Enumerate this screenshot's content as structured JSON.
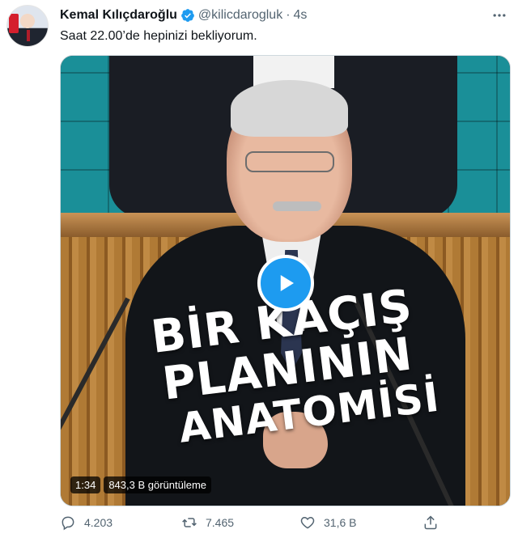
{
  "tweet": {
    "author_name": "Kemal Kılıçdaroğlu",
    "handle": "@kilicdarogluk",
    "separator": "·",
    "time": "4s",
    "text": "Saat 22.00’de hepinizi bekliyorum."
  },
  "video": {
    "overlay_line1": "BİR KAÇIŞ PLANININ",
    "overlay_line2": "ANATOMİSİ",
    "duration": "1:34",
    "views": "843,3 B görüntüleme"
  },
  "actions": {
    "replies": "4.203",
    "retweets": "7.465",
    "likes": "31,6 B"
  },
  "icons": {
    "verified": "verified-badge-icon",
    "more": "more-dots-icon",
    "play": "play-icon",
    "reply": "reply-icon",
    "retweet": "retweet-icon",
    "like": "heart-icon",
    "share": "share-icon"
  },
  "colors": {
    "accent": "#1d9bf0",
    "secondary_text": "#536471",
    "primary_text": "#0f1419"
  }
}
